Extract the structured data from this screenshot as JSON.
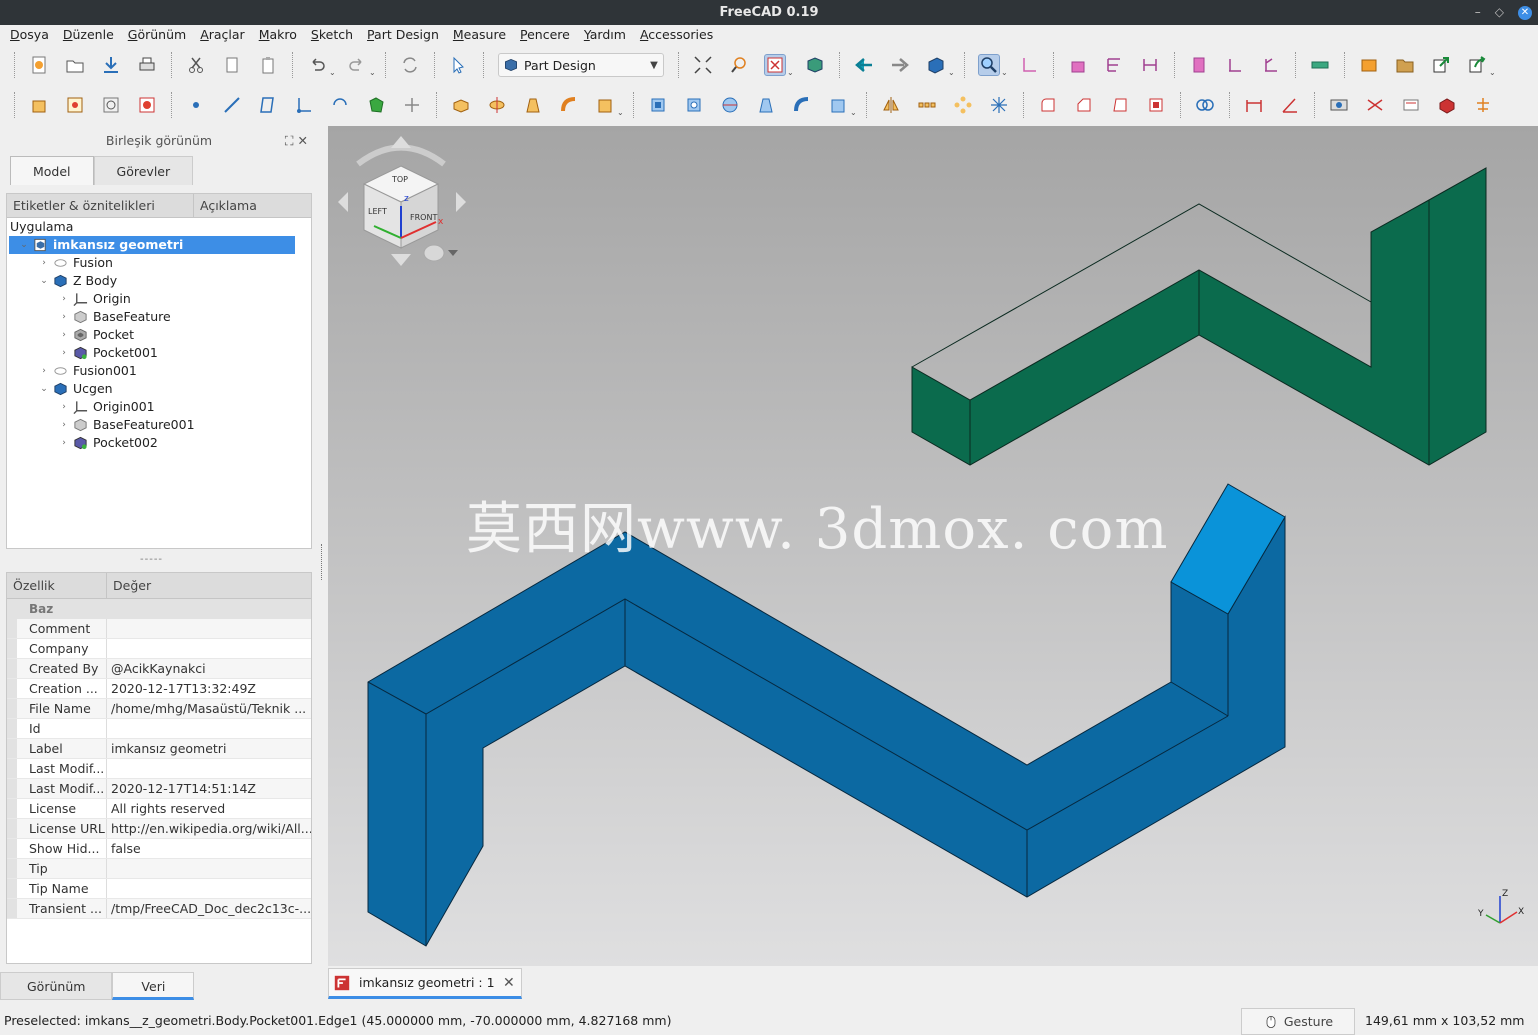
{
  "window": {
    "title": "FreeCAD 0.19"
  },
  "menu": [
    "Dosya",
    "Düzenle",
    "Görünüm",
    "Araçlar",
    "Makro",
    "Sketch",
    "Part Design",
    "Measure",
    "Pencere",
    "Yardım",
    "Accessories"
  ],
  "toolbar": {
    "workbench": "Part Design"
  },
  "combo_view": {
    "title": "Birleşik görünüm",
    "tabs": [
      "Model",
      "Görevler"
    ],
    "tree_columns": [
      "Etiketler & öznitelikleri",
      "Açıklama"
    ],
    "tree_root": "Uygulama",
    "tree": [
      {
        "label": "imkansız geometri",
        "level": 0,
        "icon": "document-icon",
        "expanded": true,
        "selected": true
      },
      {
        "label": "Fusion",
        "level": 1,
        "icon": "fusion-icon",
        "expanded": false
      },
      {
        "label": "Z Body",
        "level": 1,
        "icon": "body-icon",
        "expanded": true
      },
      {
        "label": "Origin",
        "level": 2,
        "icon": "origin-icon",
        "expanded": false
      },
      {
        "label": "BaseFeature",
        "level": 2,
        "icon": "feature-icon",
        "expanded": false
      },
      {
        "label": "Pocket",
        "level": 2,
        "icon": "pocket-icon",
        "expanded": false
      },
      {
        "label": "Pocket001",
        "level": 2,
        "icon": "pocket-tip-icon",
        "expanded": false
      },
      {
        "label": "Fusion001",
        "level": 1,
        "icon": "fusion-icon",
        "expanded": false
      },
      {
        "label": "Ucgen",
        "level": 1,
        "icon": "body-icon",
        "expanded": true
      },
      {
        "label": "Origin001",
        "level": 2,
        "icon": "origin-icon",
        "expanded": false
      },
      {
        "label": "BaseFeature001",
        "level": 2,
        "icon": "feature-icon",
        "expanded": false
      },
      {
        "label": "Pocket002",
        "level": 2,
        "icon": "pocket-tip-icon",
        "expanded": false
      }
    ],
    "splitter": "-----",
    "property_columns": [
      "Özellik",
      "Değer"
    ],
    "property_group": "Baz",
    "properties": [
      {
        "name": "Comment",
        "value": ""
      },
      {
        "name": "Company",
        "value": ""
      },
      {
        "name": "Created By",
        "value": "@AcikKaynakci"
      },
      {
        "name": "Creation ...",
        "value": "2020-12-17T13:32:49Z"
      },
      {
        "name": "File Name",
        "value": "/home/mhg/Masaüstü/Teknik ..."
      },
      {
        "name": "Id",
        "value": ""
      },
      {
        "name": "Label",
        "value": "imkansız geometri"
      },
      {
        "name": "Last Modif...",
        "value": ""
      },
      {
        "name": "Last Modif...",
        "value": "2020-12-17T14:51:14Z"
      },
      {
        "name": "License",
        "value": "All rights reserved"
      },
      {
        "name": "License URL",
        "value": "http://en.wikipedia.org/wiki/All..."
      },
      {
        "name": "Show Hid...",
        "value": "false"
      },
      {
        "name": "Tip",
        "value": ""
      },
      {
        "name": "Tip Name",
        "value": ""
      },
      {
        "name": "Transient ...",
        "value": "/tmp/FreeCAD_Doc_dec2c13c-..."
      }
    ],
    "bottom_tabs": [
      "Görünüm",
      "Veri"
    ]
  },
  "viewport": {
    "watermark": "莫西网www. 3dmox. com",
    "navcube": {
      "top": "TOP",
      "front": "FRONT",
      "left": "LEFT",
      "axis_x": "x",
      "axis_z": "z"
    },
    "axis_labels": {
      "x": "X",
      "y": "Y",
      "z": "Z"
    },
    "colors": {
      "green_top": "#0b6b4d",
      "green_side": "#08603f",
      "blue_top": "#0c69a2",
      "blue_side": "#0a5f95",
      "blue_highlight": "#0a93d9"
    }
  },
  "document_tab": {
    "label": "imkansız geometri : 1"
  },
  "status": {
    "message": "Preselected: imkans__z_geometri.Body.Pocket001.Edge1 (45.000000 mm, -70.000000 mm, 4.827168 mm)",
    "navigation_style": "Gesture",
    "dimensions": "149,61 mm x 103,52 mm"
  }
}
